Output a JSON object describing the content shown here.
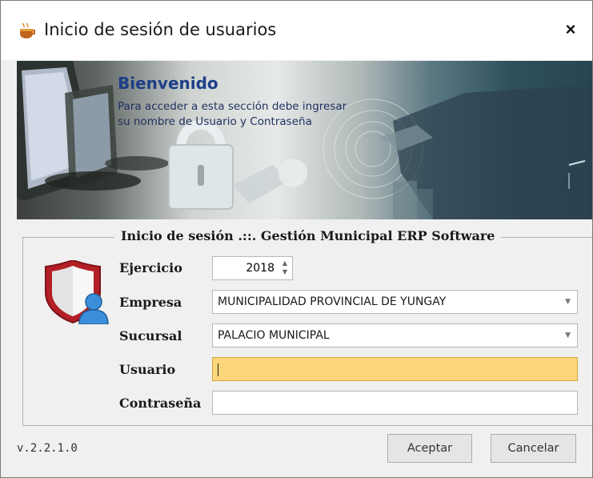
{
  "window": {
    "title": "Inicio de sesión de usuarios",
    "close_label": "×"
  },
  "banner": {
    "title": "Bienvenido",
    "subtitle_line1": "Para acceder a esta sección  debe ingresar",
    "subtitle_line2": "su nombre de Usuario y Contraseña"
  },
  "form": {
    "legend": "Inicio de sesión .::. Gestión Municipal ERP Software",
    "ejercicio": {
      "label": "Ejercicio",
      "value": "2018"
    },
    "empresa": {
      "label": "Empresa",
      "value": "MUNICIPALIDAD PROVINCIAL DE YUNGAY"
    },
    "sucursal": {
      "label": "Sucursal",
      "value": "PALACIO MUNICIPAL"
    },
    "usuario": {
      "label": "Usuario",
      "value": ""
    },
    "contrasena": {
      "label": "Contraseña",
      "value": ""
    }
  },
  "footer": {
    "version": "v.2.2.1.0",
    "accept_label": "Aceptar",
    "cancel_label": "Cancelar"
  },
  "colors": {
    "accent_title": "#1e3f87",
    "usuario_highlight": "#fdd57a",
    "shield_red": "#c0262c",
    "user_blue": "#3a8fd8"
  },
  "icons": {
    "app": "coffee-cup-icon",
    "close": "close-icon",
    "shield": "shield-user-icon",
    "dropdown": "chevron-down-icon",
    "spinner": "spinner-arrows-icon"
  }
}
